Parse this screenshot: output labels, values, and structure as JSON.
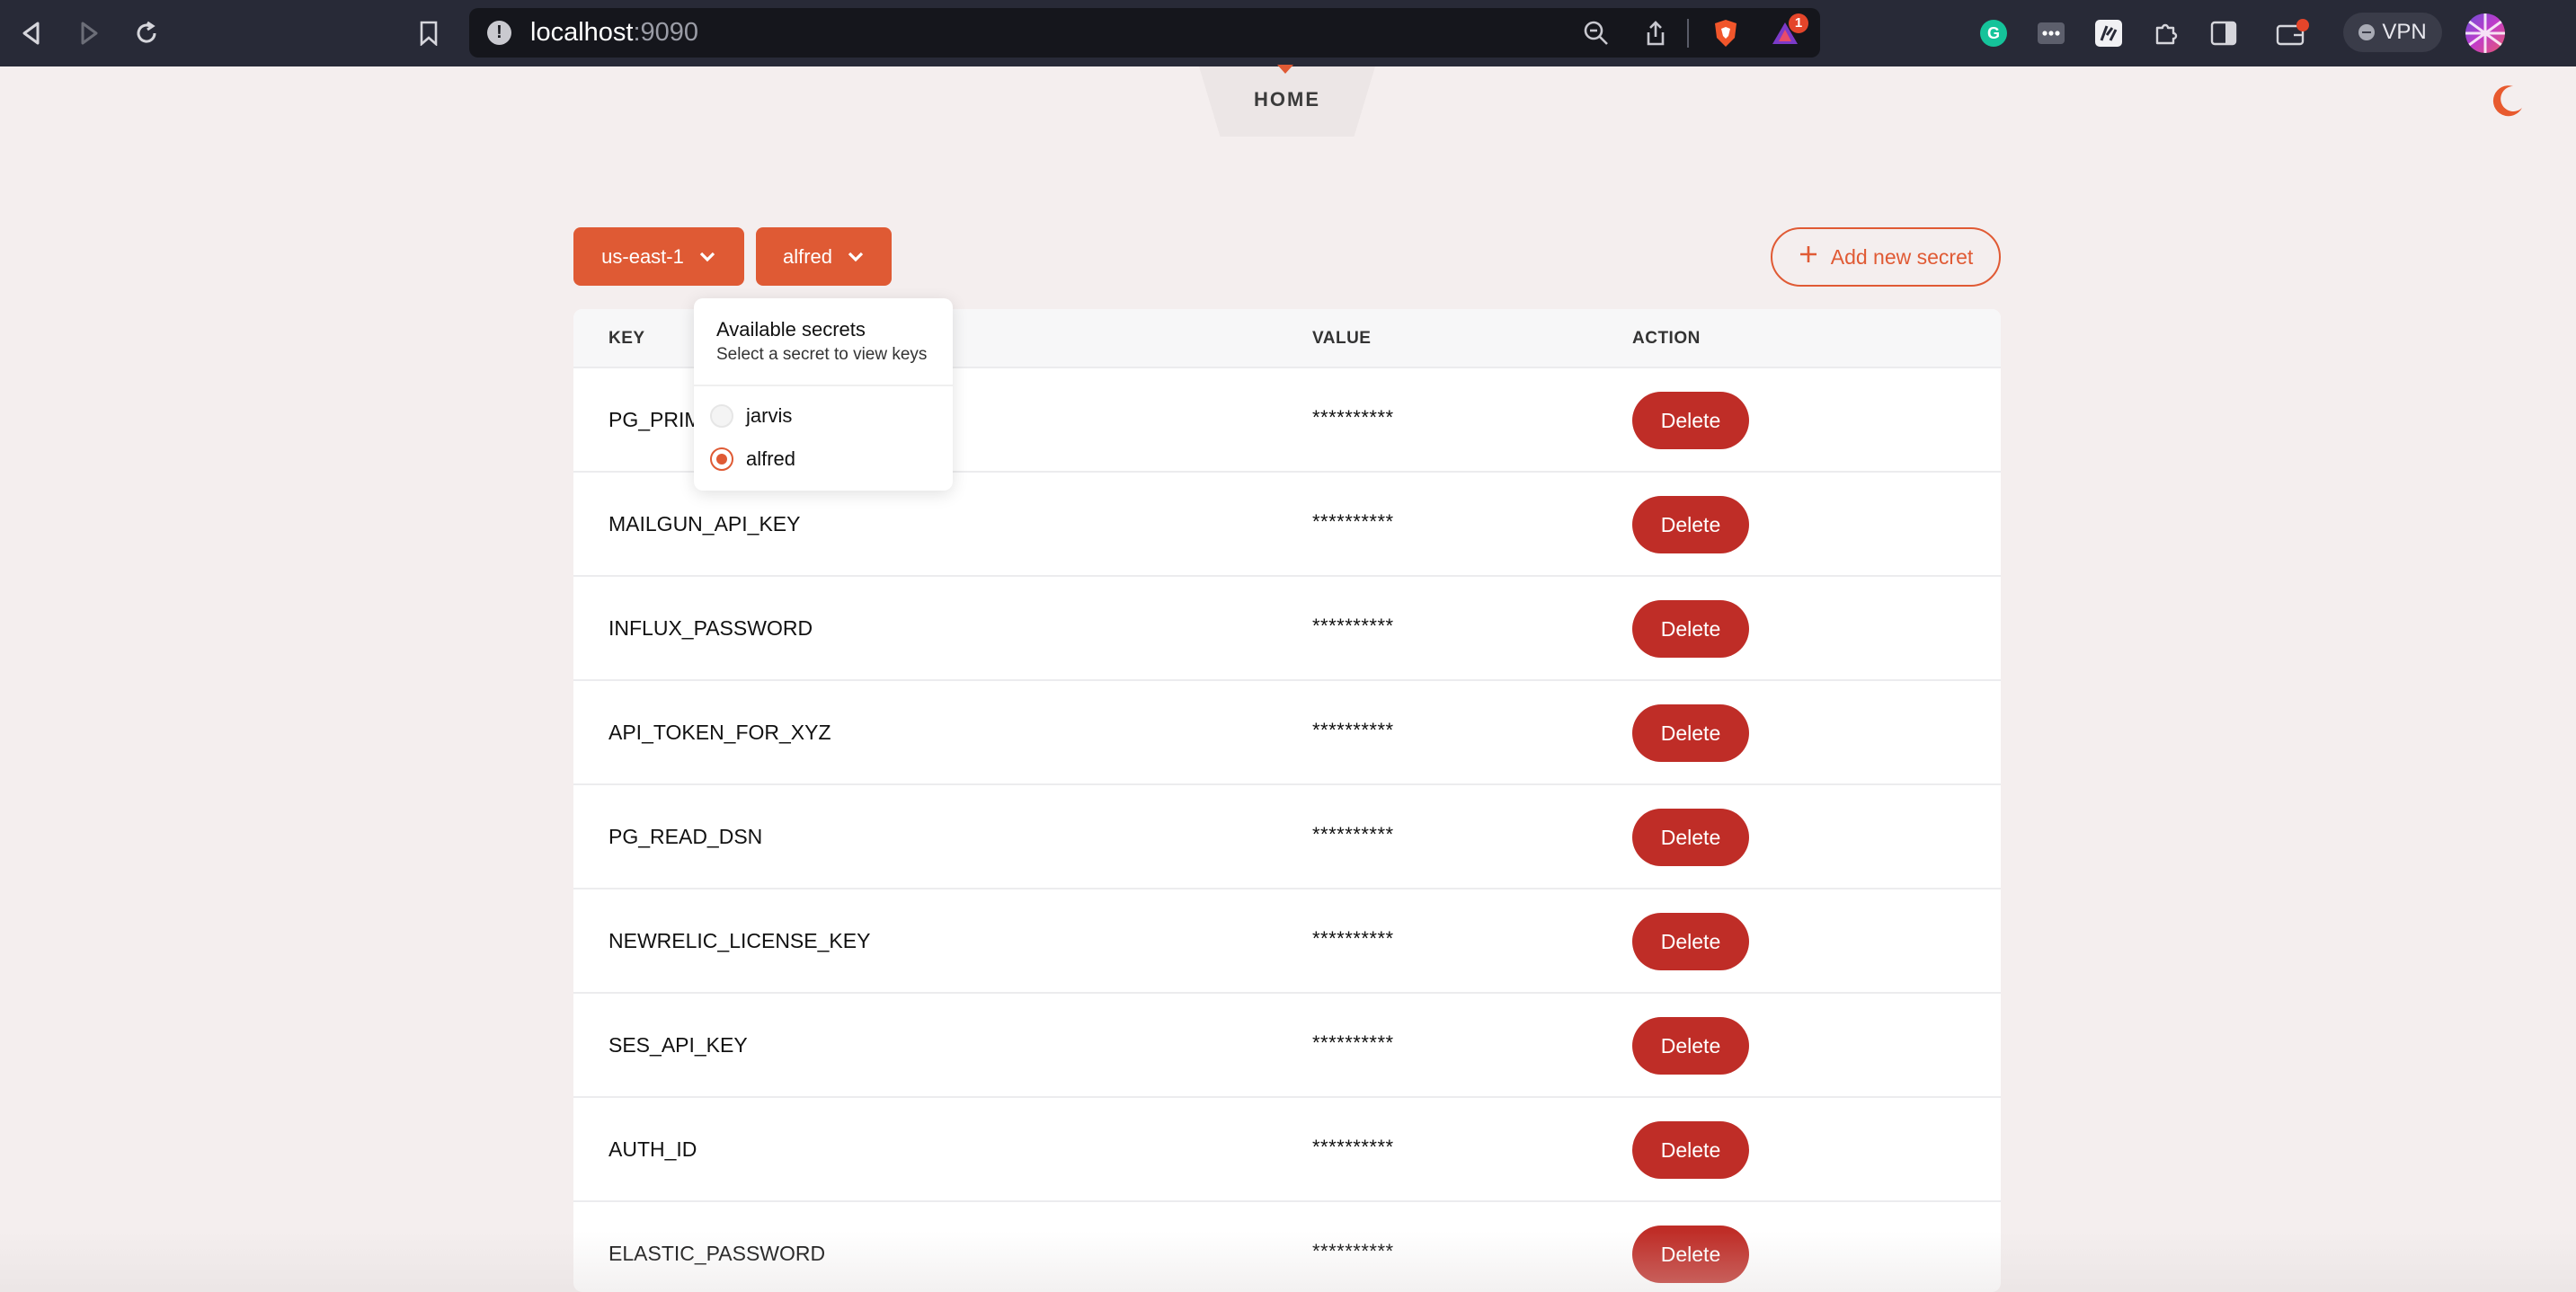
{
  "browser": {
    "url_host": "localhost",
    "url_port": ":9090",
    "notification_count": "1",
    "vpn_label": "VPN"
  },
  "header": {
    "home_label": "HOME"
  },
  "controls": {
    "region": "us-east-1",
    "secret": "alfred",
    "add_label": "Add new secret"
  },
  "table": {
    "columns": {
      "key": "KEY",
      "value": "VALUE",
      "action": "ACTION"
    },
    "rows": [
      {
        "key": "PG_PRIM",
        "value": "**********",
        "action": "Delete"
      },
      {
        "key": "MAILGUN_API_KEY",
        "value": "**********",
        "action": "Delete"
      },
      {
        "key": "INFLUX_PASSWORD",
        "value": "**********",
        "action": "Delete"
      },
      {
        "key": "API_TOKEN_FOR_XYZ",
        "value": "**********",
        "action": "Delete"
      },
      {
        "key": "PG_READ_DSN",
        "value": "**********",
        "action": "Delete"
      },
      {
        "key": "NEWRELIC_LICENSE_KEY",
        "value": "**********",
        "action": "Delete"
      },
      {
        "key": "SES_API_KEY",
        "value": "**********",
        "action": "Delete"
      },
      {
        "key": "AUTH_ID",
        "value": "**********",
        "action": "Delete"
      },
      {
        "key": "ELASTIC_PASSWORD",
        "value": "**********",
        "action": "Delete"
      }
    ]
  },
  "popover": {
    "title": "Available secrets",
    "subtitle": "Select a secret to view keys",
    "options": [
      {
        "label": "jarvis",
        "selected": false
      },
      {
        "label": "alfred",
        "selected": true
      }
    ]
  },
  "colors": {
    "accent": "#df5a34",
    "delete": "#bf2d27",
    "background": "#f4eeee"
  }
}
